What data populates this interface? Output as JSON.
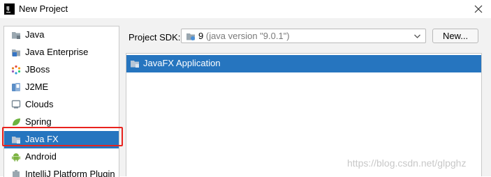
{
  "window": {
    "title": "New Project",
    "app_icon_text": "IJ"
  },
  "sidebar": {
    "items": [
      {
        "label": "Java",
        "icon": "folder-icon"
      },
      {
        "label": "Java Enterprise",
        "icon": "java-enterprise-icon"
      },
      {
        "label": "JBoss",
        "icon": "jboss-icon"
      },
      {
        "label": "J2ME",
        "icon": "j2me-icon"
      },
      {
        "label": "Clouds",
        "icon": "clouds-icon"
      },
      {
        "label": "Spring",
        "icon": "spring-leaf-icon"
      },
      {
        "label": "Java FX",
        "icon": "folder-icon",
        "selected": true
      },
      {
        "label": "Android",
        "icon": "android-icon"
      },
      {
        "label": "IntelliJ Platform Plugin",
        "icon": "plugin-icon"
      }
    ]
  },
  "sdk": {
    "label": "Project SDK:",
    "value_name": "9",
    "value_detail": "(java version \"9.0.1\")",
    "new_button": "New..."
  },
  "templates": [
    {
      "label": "JavaFX Application",
      "selected": true
    }
  ],
  "watermark": "https://blog.csdn.net/glpghz",
  "colors": {
    "selection": "#2675bf",
    "highlight_box": "#e8231e",
    "dialog_bg": "#f2f2f2"
  }
}
